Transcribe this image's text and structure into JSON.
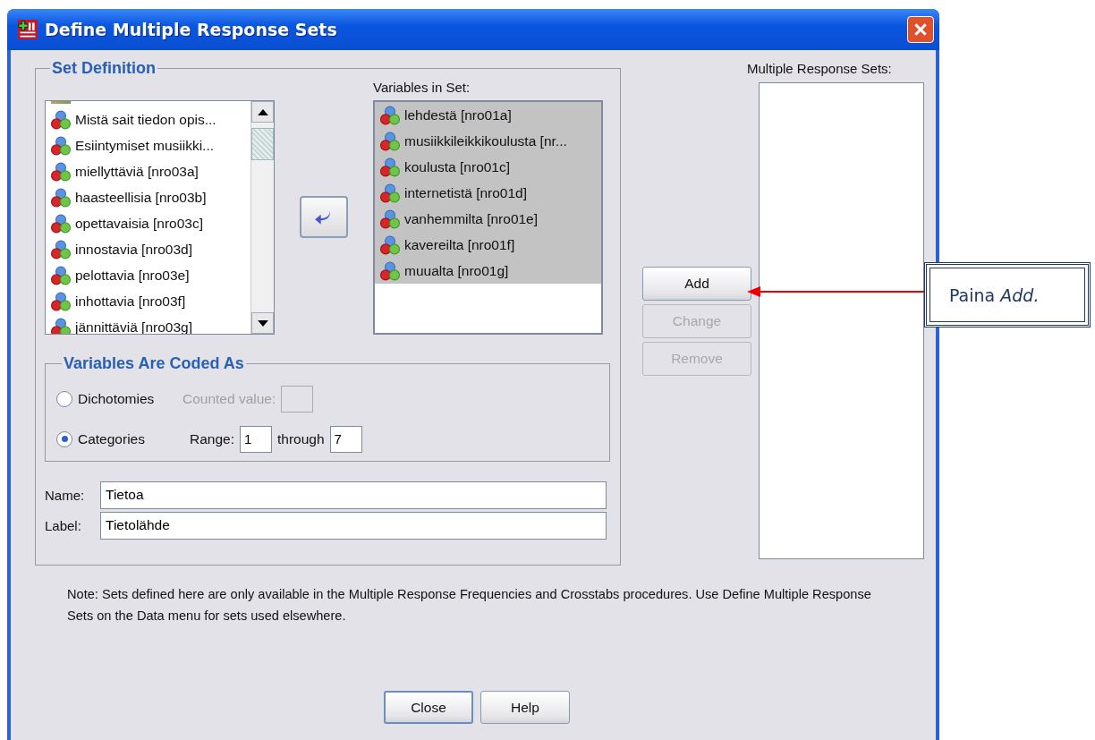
{
  "window": {
    "title": "Define Multiple Response Sets"
  },
  "set_definition": {
    "title": "Set Definition",
    "source_list": {
      "items": [
        {
          "label": "Mistä sait tiedon opis...",
          "selected": false
        },
        {
          "label": "Esiintymiset musiikki...",
          "selected": false
        },
        {
          "label": "miellyttäviä [nro03a]",
          "selected": false
        },
        {
          "label": "haasteellisia [nro03b]",
          "selected": false
        },
        {
          "label": "opettavaisia [nro03c]",
          "selected": false
        },
        {
          "label": "innostavia [nro03d]",
          "selected": false
        },
        {
          "label": "pelottavia [nro03e]",
          "selected": false
        },
        {
          "label": "inhottavia [nro03f]",
          "selected": false
        },
        {
          "label": "jännittäviä [nro03g]",
          "selected": false
        }
      ]
    },
    "variables_in_set": {
      "label": "Variables in Set:",
      "items": [
        {
          "label": "lehdestä [nro01a]",
          "selected": true
        },
        {
          "label": "musiikkileikkikoulusta [nr...",
          "selected": true
        },
        {
          "label": "koulusta [nro01c]",
          "selected": true
        },
        {
          "label": "internetistä [nro01d]",
          "selected": true
        },
        {
          "label": "vanhemmilta [nro01e]",
          "selected": true
        },
        {
          "label": "kavereilta [nro01f]",
          "selected": true
        },
        {
          "label": "muualta [nro01g]",
          "selected": true
        }
      ]
    },
    "coded_as": {
      "title": "Variables Are Coded As",
      "options": [
        {
          "label": "Dichotomies",
          "selected": false,
          "extra_label": "Counted value:"
        },
        {
          "label": "Categories",
          "selected": true,
          "range_label": "Range:",
          "range_from": "1",
          "through_label": "through",
          "range_to": "7"
        }
      ]
    },
    "name": {
      "label": "Name:",
      "value": "Tietoa"
    },
    "label": {
      "label": "Label:",
      "value": "Tietolähde"
    }
  },
  "side_buttons": [
    {
      "label": "Add",
      "disabled": false
    },
    {
      "label": "Change",
      "disabled": true
    },
    {
      "label": "Remove",
      "disabled": true
    }
  ],
  "response_sets": {
    "label": "Multiple Response Sets:"
  },
  "note": "Note: Sets defined here are only available in the Multiple Response Frequencies and Crosstabs procedures. Use Define Multiple Response Sets on the Data menu for sets used elsewhere.",
  "buttons": [
    {
      "label": "Close",
      "default": true
    },
    {
      "label": "Help",
      "default": false
    }
  ],
  "callout": {
    "text": "Paina *Add.*"
  }
}
